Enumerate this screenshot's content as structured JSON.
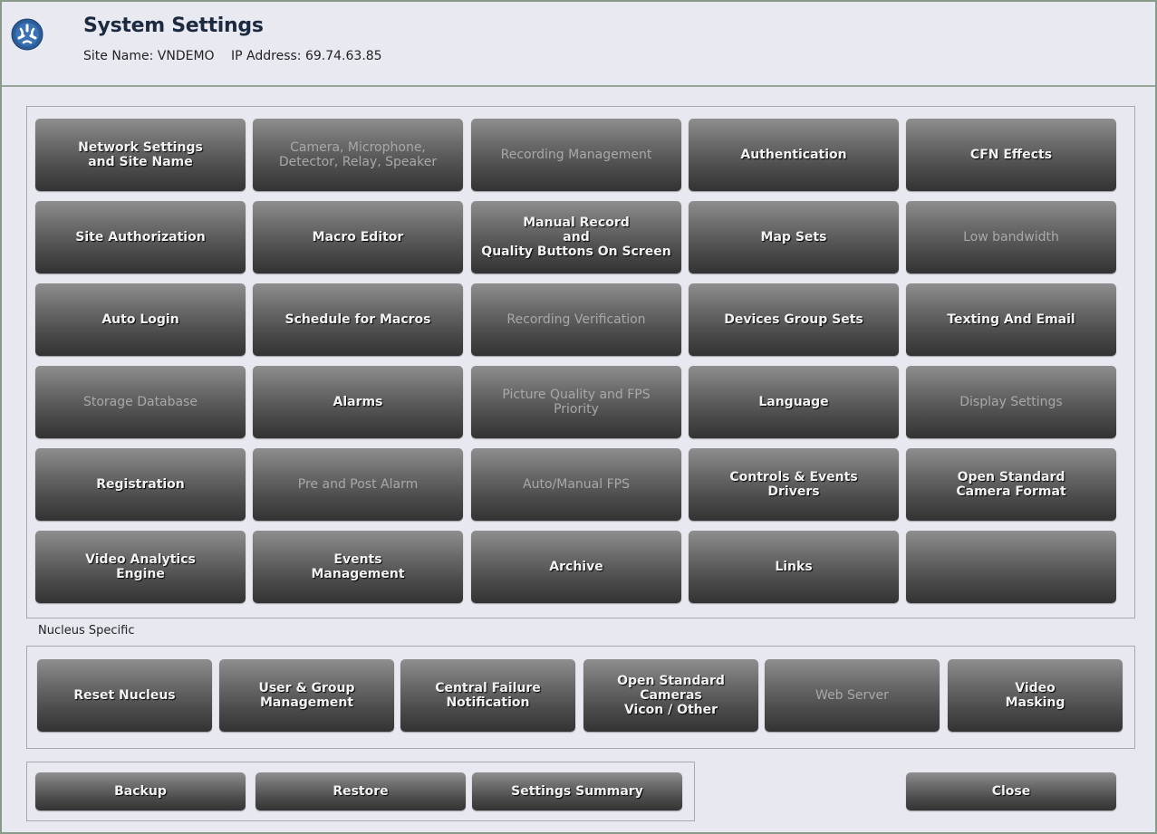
{
  "header": {
    "title": "System Settings",
    "site_name": "Site Name: VNDEMO",
    "ip_address": "IP Address: 69.74.63.85",
    "logo_icon": "asterisk-logo-icon"
  },
  "grid": {
    "rows": [
      [
        {
          "label": "Network Settings\nand Site Name",
          "enabled": true
        },
        {
          "label": "Camera,  Microphone,\nDetector, Relay, Speaker",
          "enabled": false
        },
        {
          "label": "Recording Management",
          "enabled": false
        },
        {
          "label": "Authentication",
          "enabled": true
        },
        {
          "label": "CFN Effects",
          "enabled": true
        }
      ],
      [
        {
          "label": "Site Authorization",
          "enabled": true
        },
        {
          "label": "Macro Editor",
          "enabled": true
        },
        {
          "label": "Manual Record\nand\nQuality Buttons On Screen",
          "enabled": true
        },
        {
          "label": "Map Sets",
          "enabled": true
        },
        {
          "label": "Low bandwidth",
          "enabled": false
        }
      ],
      [
        {
          "label": "Auto Login",
          "enabled": true
        },
        {
          "label": "Schedule for Macros",
          "enabled": true
        },
        {
          "label": "Recording Verification",
          "enabled": false
        },
        {
          "label": "Devices Group Sets",
          "enabled": true
        },
        {
          "label": "Texting And Email",
          "enabled": true
        }
      ],
      [
        {
          "label": "Storage Database",
          "enabled": false
        },
        {
          "label": "Alarms",
          "enabled": true
        },
        {
          "label": "Picture Quality and FPS\nPriority",
          "enabled": false
        },
        {
          "label": "Language",
          "enabled": true
        },
        {
          "label": "Display Settings",
          "enabled": false
        }
      ],
      [
        {
          "label": "Registration",
          "enabled": true
        },
        {
          "label": "Pre and Post Alarm",
          "enabled": false
        },
        {
          "label": "Auto/Manual FPS",
          "enabled": false
        },
        {
          "label": "Controls & Events\nDrivers",
          "enabled": true
        },
        {
          "label": "Open Standard\nCamera Format",
          "enabled": true
        }
      ],
      [
        {
          "label": "Video Analytics\nEngine",
          "enabled": true
        },
        {
          "label": "Events\nManagement",
          "enabled": true
        },
        {
          "label": "Archive",
          "enabled": true
        },
        {
          "label": "Links",
          "enabled": true
        },
        {
          "label": "",
          "enabled": true
        }
      ]
    ]
  },
  "nucleus": {
    "section_label": "Nucleus Specific",
    "buttons": [
      {
        "label": "Reset Nucleus",
        "enabled": true
      },
      {
        "label": "User & Group\nManagement",
        "enabled": true
      },
      {
        "label": "Central Failure\nNotification",
        "enabled": true
      },
      {
        "label": "Open Standard\nCameras\nVicon / Other",
        "enabled": true
      },
      {
        "label": "Web Server",
        "enabled": false
      },
      {
        "label": "Video\nMasking",
        "enabled": true
      }
    ]
  },
  "footer": {
    "backup": "Backup",
    "restore": "Restore",
    "settings_summary": "Settings Summary",
    "close": "Close"
  }
}
